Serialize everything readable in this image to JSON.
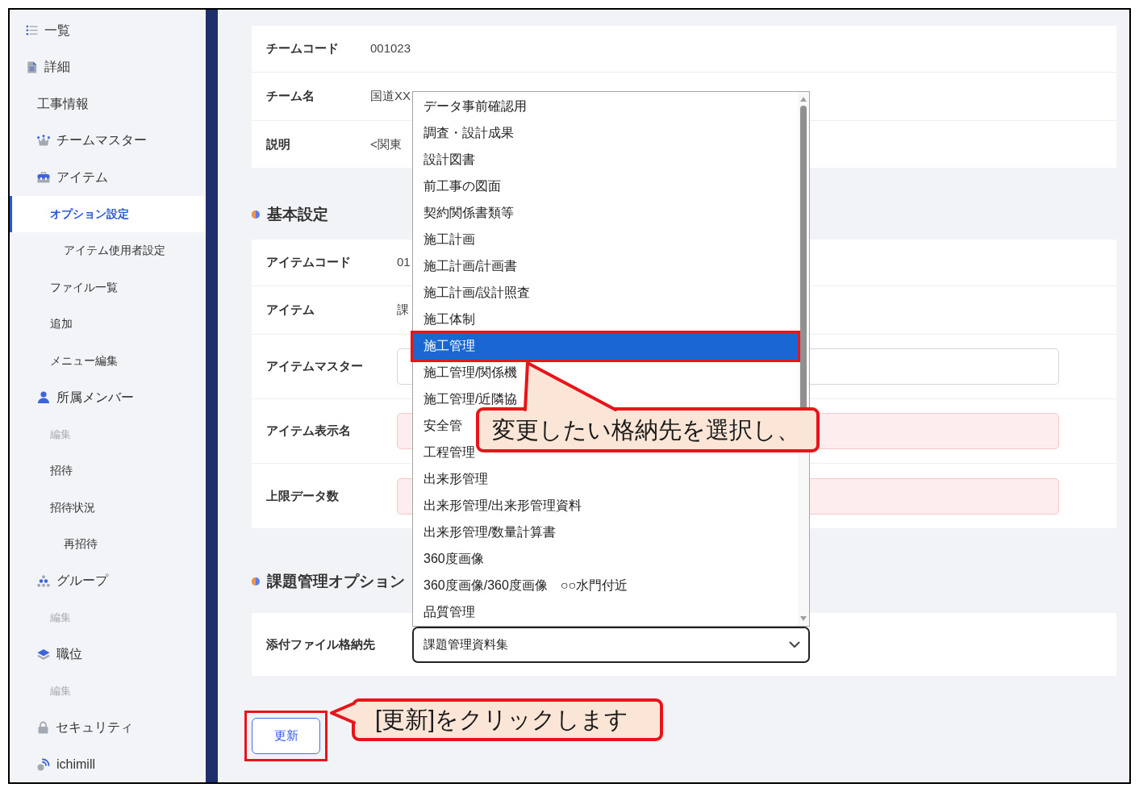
{
  "sidebar": {
    "items": [
      {
        "label": "一覧",
        "selected": false,
        "disabled": false
      },
      {
        "label": "詳細",
        "selected": false,
        "disabled": false,
        "children": [
          {
            "label": "工事情報",
            "selected": false,
            "disabled": false
          },
          {
            "label": "チームマスター",
            "selected": false,
            "disabled": false
          },
          {
            "label": "アイテム",
            "selected": false,
            "disabled": false,
            "children": [
              {
                "label": "オプション設定",
                "selected": true,
                "disabled": false,
                "children": [
                  {
                    "label": "アイテム使用者設定",
                    "selected": false,
                    "disabled": false
                  }
                ]
              },
              {
                "label": "ファイル一覧",
                "selected": false,
                "disabled": false
              },
              {
                "label": "追加",
                "selected": false,
                "disabled": false
              },
              {
                "label": "メニュー編集",
                "selected": false,
                "disabled": false
              }
            ]
          },
          {
            "label": "所属メンバー",
            "selected": false,
            "disabled": false,
            "children": [
              {
                "label": "編集",
                "selected": false,
                "disabled": true
              },
              {
                "label": "招待",
                "selected": false,
                "disabled": false
              },
              {
                "label": "招待状況",
                "selected": false,
                "disabled": false,
                "children": [
                  {
                    "label": "再招待",
                    "selected": false,
                    "disabled": false
                  }
                ]
              }
            ]
          },
          {
            "label": "グループ",
            "selected": false,
            "disabled": false,
            "children": [
              {
                "label": "編集",
                "selected": false,
                "disabled": true
              }
            ]
          },
          {
            "label": "職位",
            "selected": false,
            "disabled": false,
            "children": [
              {
                "label": "編集",
                "selected": false,
                "disabled": true
              }
            ]
          },
          {
            "label": "セキュリティ",
            "selected": false,
            "disabled": false
          },
          {
            "label": "ichimill",
            "selected": false,
            "disabled": false
          }
        ]
      }
    ]
  },
  "team_info": {
    "rows": [
      {
        "label": "チームコード",
        "value": "001023"
      },
      {
        "label": "チーム名",
        "value": "国道XX"
      },
      {
        "label": "説明",
        "value": "<関東"
      }
    ]
  },
  "basic_settings": {
    "title": "基本設定",
    "rows": [
      {
        "kind": "text",
        "label": "アイテムコード",
        "value": "01"
      },
      {
        "kind": "text",
        "label": "アイテム",
        "value": "課"
      },
      {
        "kind": "input",
        "label": "アイテムマスター",
        "error": false
      },
      {
        "kind": "input",
        "label": "アイテム表示名",
        "error": true
      },
      {
        "kind": "input",
        "label": "上限データ数",
        "error": true
      }
    ]
  },
  "issue_options": {
    "title": "課題管理オプション",
    "rows": [
      {
        "kind": "select",
        "label": "添付ファイル格納先",
        "value": "課題管理資料集",
        "expanded": true,
        "options": [
          {
            "label": "データ事前確認用",
            "selected": false,
            "highlighted": false
          },
          {
            "label": "調査・設計成果",
            "selected": false,
            "highlighted": false
          },
          {
            "label": "設計図書",
            "selected": false,
            "highlighted": false
          },
          {
            "label": "前工事の図面",
            "selected": false,
            "highlighted": false
          },
          {
            "label": "契約関係書類等",
            "selected": false,
            "highlighted": false
          },
          {
            "label": "施工計画",
            "selected": false,
            "highlighted": false
          },
          {
            "label": "施工計画/計画書",
            "selected": false,
            "highlighted": false
          },
          {
            "label": "施工計画/設計照査",
            "selected": false,
            "highlighted": false
          },
          {
            "label": "施工体制",
            "selected": false,
            "highlighted": false
          },
          {
            "label": "施工管理",
            "selected": true,
            "highlighted": true
          },
          {
            "label": "施工管理/関係機",
            "selected": false,
            "highlighted": false
          },
          {
            "label": "施工管理/近隣協",
            "selected": false,
            "highlighted": false
          },
          {
            "label": "安全管",
            "selected": false,
            "highlighted": false
          },
          {
            "label": "工程管理",
            "selected": false,
            "highlighted": false
          },
          {
            "label": "出来形管理",
            "selected": false,
            "highlighted": false
          },
          {
            "label": "出来形管理/出来形管理資料",
            "selected": false,
            "highlighted": false
          },
          {
            "label": "出来形管理/数量計算書",
            "selected": false,
            "highlighted": false
          },
          {
            "label": "360度画像",
            "selected": false,
            "highlighted": false
          },
          {
            "label": "360度画像/360度画像　○○水門付近",
            "selected": false,
            "highlighted": false
          },
          {
            "label": "品質管理",
            "selected": false,
            "highlighted": false
          }
        ]
      }
    ]
  },
  "update_button": {
    "label": "更新",
    "highlighted": true
  },
  "callouts": [
    {
      "kind": "up",
      "text": "変更したい格納先を選択し、"
    },
    {
      "kind": "left",
      "text": "[更新]をクリックします"
    }
  ]
}
